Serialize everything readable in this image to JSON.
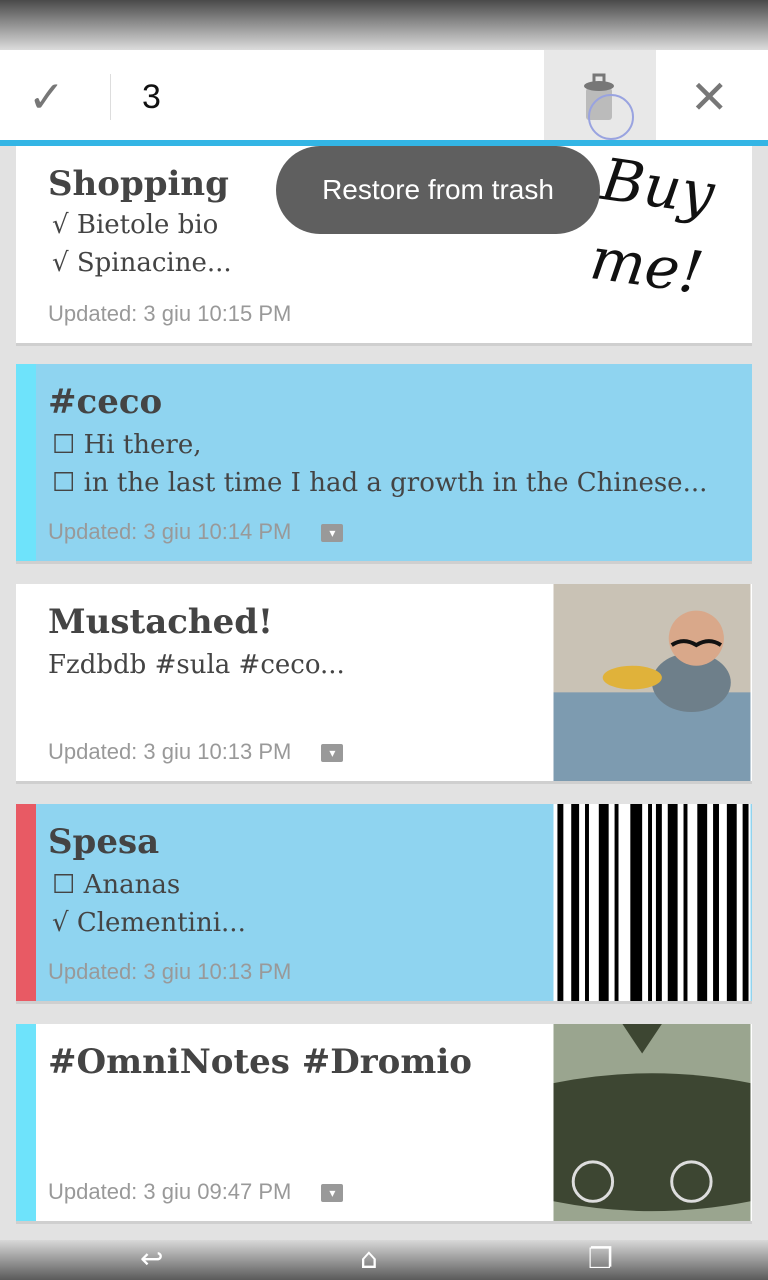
{
  "action_bar": {
    "selected_count": "3",
    "check_icon": "check-icon",
    "restore_icon": "restore-from-trash-icon",
    "close_icon": "close-icon"
  },
  "toast": "Restore from trash",
  "notes": [
    {
      "title": "Shopping",
      "lines": [
        "√ Bietole bio",
        "√ Spinacine..."
      ],
      "updated": "Updated: 3 giu 10:15 PM",
      "handwriting": "Buy me!"
    },
    {
      "title": "#ceco",
      "lines": [
        "☐ Hi there,",
        "☐ in the last time I had a growth in the Chinese..."
      ],
      "updated": "Updated: 3 giu 10:14 PM",
      "stripe": "#6ee3fb",
      "selected": true,
      "archived": true
    },
    {
      "title": "Mustached!",
      "lines": [
        "Fzdbdb #sula #ceco..."
      ],
      "updated": "Updated: 3 giu 10:13 PM",
      "archived": true
    },
    {
      "title": "Spesa",
      "lines": [
        "☐ Ananas",
        "√ Clementini..."
      ],
      "updated": "Updated: 3 giu 10:13 PM",
      "stripe": "#e85a64",
      "selected": true
    },
    {
      "title": "#OmniNotes #Dromio",
      "lines": [],
      "updated": "Updated: 3 giu 09:47 PM",
      "stripe": "#6ee3fb",
      "archived": true
    }
  ],
  "colors": {
    "accent": "#33b5e5",
    "selected": "#8fd4f0"
  }
}
